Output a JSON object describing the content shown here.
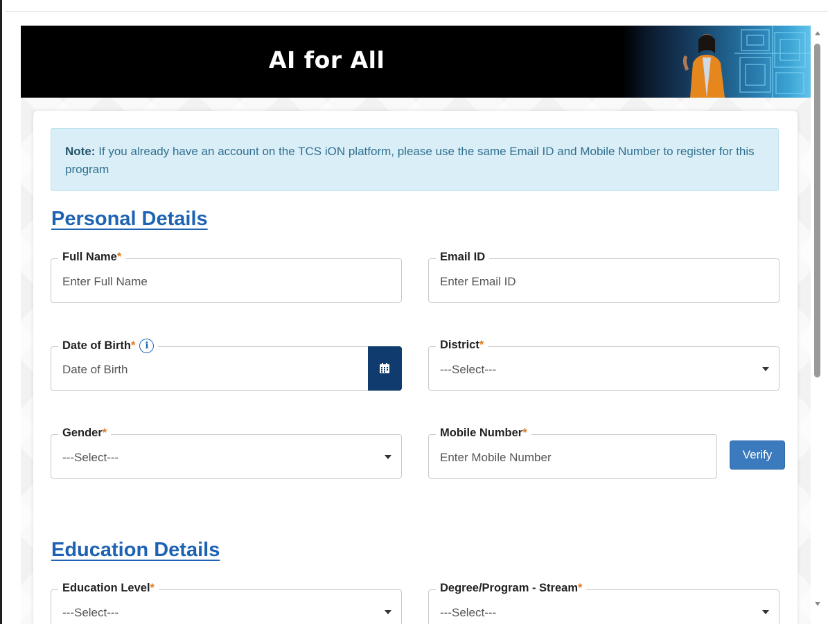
{
  "banner": {
    "title": "AI for All"
  },
  "note": {
    "prefix": "Note:",
    "text": "If you already have an account on the TCS iON platform, please use the same Email ID and Mobile Number to register for this program"
  },
  "sections": {
    "personal": "Personal Details",
    "education": "Education Details"
  },
  "fields": {
    "full_name": {
      "label": "Full Name",
      "required": "*",
      "placeholder": "Enter Full Name"
    },
    "email": {
      "label": "Email ID",
      "placeholder": "Enter Email ID"
    },
    "dob": {
      "label": "Date of Birth",
      "required": "*",
      "placeholder": "Date of Birth",
      "info": "i"
    },
    "district": {
      "label": "District",
      "required": "*",
      "value": "---Select---"
    },
    "gender": {
      "label": "Gender",
      "required": "*",
      "value": "---Select---"
    },
    "mobile": {
      "label": "Mobile Number",
      "required": "*",
      "placeholder": "Enter Mobile Number"
    },
    "education_level": {
      "label": "Education Level",
      "required": "*",
      "value": "---Select---"
    },
    "degree_stream": {
      "label": "Degree/Program - Stream",
      "required": "*",
      "value": "---Select---"
    }
  },
  "buttons": {
    "verify": "Verify"
  },
  "colors": {
    "accent": "#1e63b3",
    "required": "#e07b21",
    "calendar_button": "#0f3b6e",
    "verify_button": "#3b7bbd",
    "note_background": "#d9eef7"
  }
}
